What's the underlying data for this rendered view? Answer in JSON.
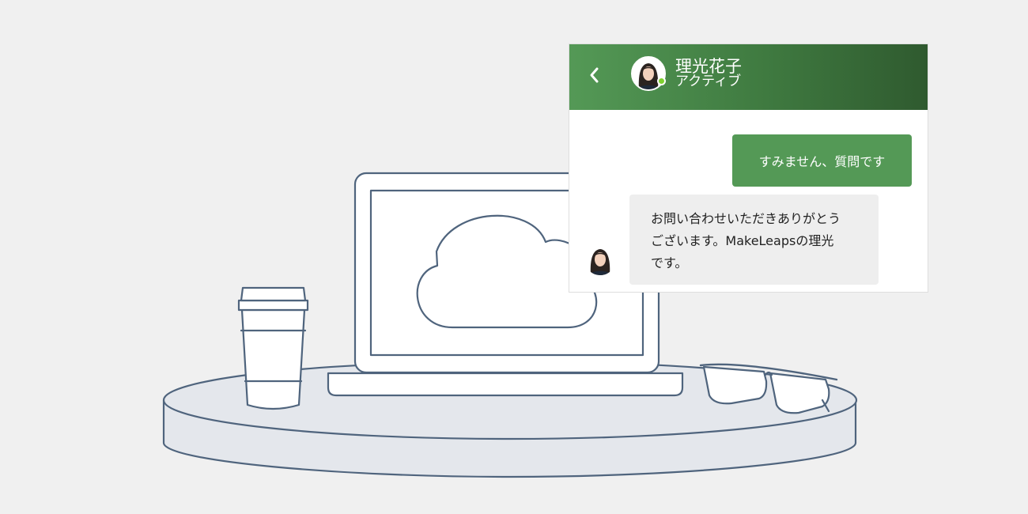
{
  "chat": {
    "agent_name": "理光花子",
    "agent_status": "アクティブ",
    "status_color": "#7fd12f",
    "header_color": "#549956",
    "messages": [
      {
        "sender": "user",
        "text": "すみません、質問です"
      },
      {
        "sender": "agent",
        "lines": [
          "お問い合わせいただきありがとう",
          "ございます。MakeLeapsの理光",
          "です。"
        ]
      }
    ],
    "icons": {
      "back": "chevron-left-icon"
    }
  },
  "illustration": {
    "items": [
      "laptop",
      "cloud",
      "coffee-cup",
      "glasses",
      "round-table"
    ],
    "line_color": "#4f647d",
    "table_fill": "#e4e7ec"
  }
}
